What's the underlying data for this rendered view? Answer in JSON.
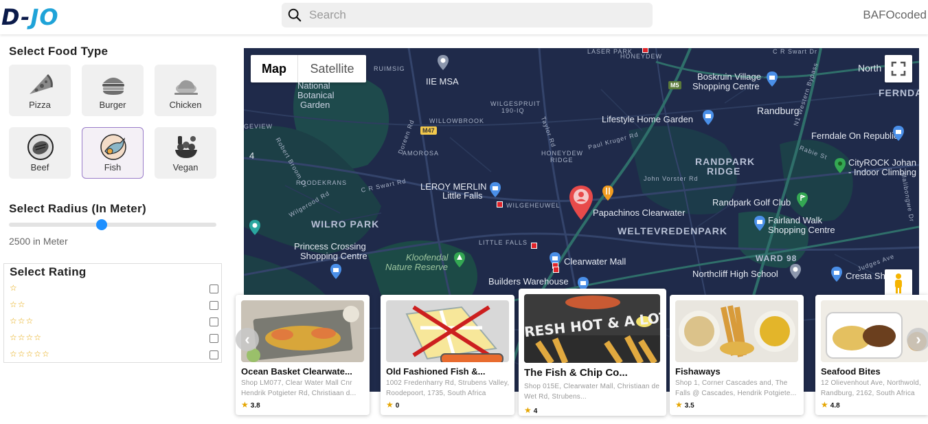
{
  "header": {
    "logo_left": "D-",
    "logo_right": "JO",
    "search_placeholder": "Search",
    "username": "BAFOcoded"
  },
  "sidebar": {
    "food_title": "Select Food Type",
    "foods": [
      {
        "label": "Pizza",
        "icon": "pizza-icon",
        "selected": false
      },
      {
        "label": "Burger",
        "icon": "burger-icon",
        "selected": false
      },
      {
        "label": "Chicken",
        "icon": "chicken-icon",
        "selected": false
      },
      {
        "label": "Beef",
        "icon": "beef-icon",
        "selected": false
      },
      {
        "label": "Fish",
        "icon": "fish-icon",
        "selected": true
      },
      {
        "label": "Vegan",
        "icon": "vegan-icon",
        "selected": false
      }
    ],
    "radius_title": "Select Radius (In Meter)",
    "radius_value": "2500 in Meter",
    "radius_fraction": 0.448,
    "rating_title": "Select Rating",
    "ratings": [
      {
        "stars": "☆",
        "checked": false
      },
      {
        "stars": "☆☆",
        "checked": false
      },
      {
        "stars": "☆☆☆",
        "checked": false
      },
      {
        "stars": "☆☆☆☆",
        "checked": false
      },
      {
        "stars": "☆☆☆☆☆",
        "checked": false
      }
    ]
  },
  "map": {
    "map_button": "Map",
    "satellite_button": "Satellite",
    "labels": {
      "l1": "RUIMSIG",
      "l2": "IIE MSA",
      "l3": "National",
      "l4": "Botanical",
      "l5": "Garden",
      "l6": "WILGESPRUIT",
      "l7": "190-IQ",
      "l8": "WILLOWBROOK",
      "l9": "GEVIEW",
      "l10": "AMOROSA",
      "l11": "HONEYDEW",
      "l12": "RIDGE",
      "l13": "HONEYDEW",
      "l14": "Boskruin Village",
      "l15": "Shopping Centre",
      "l16": "Randburg",
      "l17": "North",
      "l18": "FERNDA",
      "l19": "Lifestyle Home Garden",
      "l20": "Ferndale On Republic",
      "l21": "ROODEKRANS",
      "l22": "LEROY MERLIN",
      "l23": "Little Falls",
      "l24": "WILGEHEUWEL",
      "l25": "RANDPARK",
      "l26": "RIDGE",
      "l27": "CityROCK Johan",
      "l28": "- Indoor Climbing",
      "l29": "John Vorster Rd",
      "l30": "Papachinos Clearwater",
      "l31": "Randpark Golf Club",
      "l32": "WILRO PARK",
      "l33": "WELTEVREDENPARK",
      "l34": "Fairland Walk",
      "l35": "Shopping Centre",
      "l36": "LITTLE FALLS",
      "l37": "Princess Crossing",
      "l38": "Shopping Centre",
      "l39": "Kloofendal",
      "l40": "Nature Reserve",
      "l41": "Clearwater Mall",
      "l42": "WARD 98",
      "l43": "Northcliff High School",
      "l44": "Cresta Sh",
      "l45": "Builders Warehouse",
      "l46": "Paul Kruger Rd",
      "l47": "C R Swart Rd",
      "l48": "Robert Broom Dr",
      "l49": "Wilgerood Rd",
      "l50": "Judges Ave",
      "l51": "N1 Western Bypass",
      "l52": "Doreen Rd",
      "l53": "Taylor Rd",
      "l54": "4",
      "m47": "M47",
      "m5": "M5",
      "l55": "LASER PARK",
      "l56": "C R Swart Dr",
      "l57": "Rabie St",
      "l58": "Malibongwe Dr"
    }
  },
  "cards": [
    {
      "name": "Ocean Basket Clearwate...",
      "address": "Shop LM077, Clear Water Mall Cnr Hendrik Potgieter Rd, Christiaan d...",
      "rating": "3.8"
    },
    {
      "name": "Old Fashioned Fish &...",
      "address": "1002 Fredenharry Rd, Strubens Valley, Roodepoort, 1735, South Africa",
      "rating": "0"
    },
    {
      "name": "The Fish & Chip Co...",
      "address": "Shop 015E, Clearwater Mall, Christiaan de Wet Rd, Strubens...",
      "rating": "4",
      "banner": "FRESH HOT & A LOT"
    },
    {
      "name": "Fishaways",
      "address": "Shop 1, Corner Cascades and, The Falls @ Cascades, Hendrik Potgiete...",
      "rating": "3.5"
    },
    {
      "name": "Seafood Bites",
      "address": "12 Olievenhout Ave, Northwold, Randburg, 2162, South Africa",
      "rating": "4.8"
    }
  ],
  "colors": {
    "accent": "#1e90ff",
    "star": "#e5a500",
    "map_bg": "#1f2a4a",
    "selected_border": "#9a7cc9"
  }
}
